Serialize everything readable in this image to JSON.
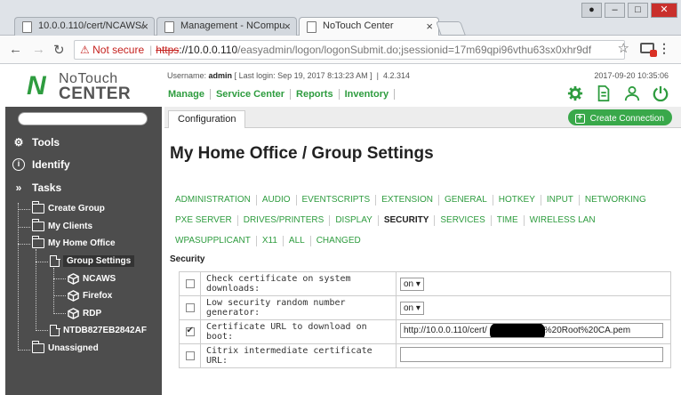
{
  "browser": {
    "tabs": [
      {
        "title": "10.0.0.110/cert/NCAWS/",
        "active": false
      },
      {
        "title": "Management - NCompu",
        "active": false
      },
      {
        "title": "NoTouch Center",
        "active": true
      }
    ],
    "not_secure": "Not secure",
    "url_scheme": "https",
    "url_host": "://10.0.0.110",
    "url_path": "/easyadmin/logon/logonSubmit.do;jsessionid=17m69qpi96vthu63sx0xhr9df"
  },
  "app": {
    "logo_line1": "NoTouch",
    "logo_line2": "CENTER",
    "username_label": "Username:",
    "username": "admin",
    "last_login": "[ Last login: Sep 19, 2017 8:13:23 AM ]",
    "version": "4.2.314",
    "datetime": "2017-09-20 10:35:06",
    "nav": [
      "Manage",
      "Service Center",
      "Reports",
      "Inventory"
    ],
    "accent": "#2e9c3f"
  },
  "sidebar": {
    "sections": [
      "Tools",
      "Identify",
      "Tasks"
    ],
    "tree": {
      "create_group": "Create Group",
      "my_clients": "My Clients",
      "my_home_office": "My Home Office",
      "group_settings": "Group Settings",
      "ncaws": "NCAWS",
      "firefox": "Firefox",
      "rdp": "RDP",
      "ntdb": "NTDB827EB2842AF",
      "unassigned": "Unassigned"
    }
  },
  "main": {
    "config_tab": "Configuration",
    "create_connection": "Create Connection",
    "title": "My Home Office / Group Settings",
    "categories_row1": [
      "ADMINISTRATION",
      "AUDIO",
      "EVENTSCRIPTS",
      "EXTENSION",
      "GENERAL",
      "HOTKEY",
      "INPUT",
      "NETWORKING"
    ],
    "categories_row2": [
      "PXE SERVER",
      "DRIVES/PRINTERS",
      "DISPLAY",
      "SECURITY",
      "SERVICES",
      "TIME",
      "WIRELESS LAN"
    ],
    "categories_row3": [
      "WPASUPPLICANT",
      "X11",
      "ALL",
      "CHANGED"
    ],
    "section": "Security",
    "settings": [
      {
        "label": "Check certificate on system downloads:",
        "checked": false,
        "value": "on"
      },
      {
        "label": "Low security random number generator:",
        "checked": false,
        "value": "on"
      },
      {
        "label": "Certificate URL to download on boot:",
        "checked": true,
        "value_prefix": "http://10.0.0.110/cert/",
        "value_suffix": "%20Root%20CA.pem"
      },
      {
        "label": "Citrix intermediate certificate URL:",
        "checked": false,
        "value": ""
      }
    ]
  }
}
